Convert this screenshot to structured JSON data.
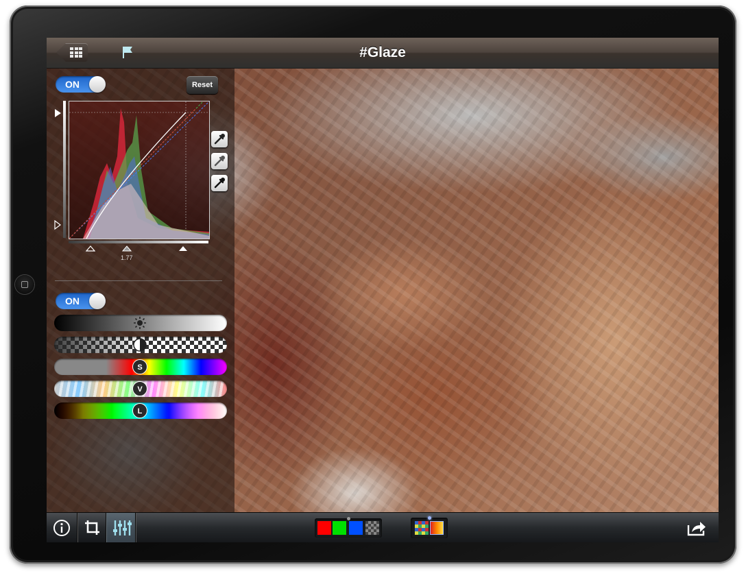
{
  "navbar": {
    "title": "#Glaze"
  },
  "curves_panel": {
    "toggle_label": "ON",
    "reset_label": "Reset",
    "gamma_value": "1.77"
  },
  "color_panel": {
    "toggle_label": "ON",
    "saturation_letter": "S",
    "vibrance_letter": "V",
    "luminance_letter": "L"
  },
  "toolbar": {
    "swatches": [
      "#ff0000",
      "#00e000",
      "#0050ff"
    ]
  },
  "colors": {
    "accent_blue": "#2a7ae2",
    "navbar_brown": "#4d433d"
  },
  "icons": [
    "grid-icon",
    "flag-icon",
    "eyedropper-black-icon",
    "eyedropper-gray-icon",
    "eyedropper-white-icon",
    "brightness-icon",
    "contrast-icon",
    "info-icon",
    "crop-icon",
    "adjust-sliders-icon",
    "share-icon"
  ]
}
